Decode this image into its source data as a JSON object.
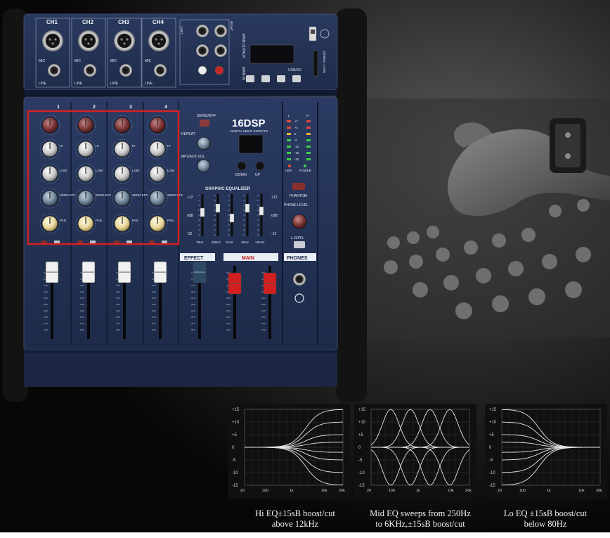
{
  "mixer": {
    "channels": [
      "CH1",
      "CH2",
      "CH3",
      "CH4"
    ],
    "channel_numbers": [
      "1",
      "2",
      "3",
      "4"
    ],
    "jack_labels": {
      "mic": "MIC",
      "line": "LINE"
    },
    "knob_labels": {
      "hi": "HI",
      "low": "LOW",
      "send_eff": "SEND EFF",
      "pan": "PAN"
    },
    "io_labels": {
      "left": "LEFT",
      "right": "RIGHT",
      "main_out": "MAIN OUT",
      "aux": "AUX",
      "main_in": "MAIN IN",
      "rca": "RCA",
      "usb_sd": "USB/SD",
      "sd_card": "SD/MMC CARD"
    },
    "dsp": {
      "logo": "16DSP",
      "subtitle": "DIGITAL MULTI EFFECTS",
      "down": "DOWN",
      "up": "UP"
    },
    "effects": {
      "send_eff": "SEND/EFF",
      "repeat": "REPEAT",
      "mp3_aux_vol": "MP3/AUX VOL"
    },
    "eq": {
      "title": "GRAPHIC EQUALIZER",
      "scale": [
        "+12",
        "0dB",
        "-12"
      ],
      "bands": [
        "75Hz",
        "250Hz",
        "1KHz",
        "3KHz",
        "12KHz"
      ]
    },
    "meter": {
      "levels": [
        "+7",
        "+4",
        "0",
        "-5",
        "-10",
        "-15",
        "-20"
      ],
      "left": "L",
      "right": "R"
    },
    "right_panel": {
      "plus48v": "+48V",
      "power": "POWER",
      "phantom": "PHANTOM",
      "phone_level": "PHONE LEVEL",
      "lr_pfl": "L-R/PFL",
      "phones": "PHONES"
    },
    "fader_sections": {
      "effect": "EFFECT",
      "main": "MAIN"
    },
    "colors": {
      "panel": "#253458",
      "highlight_box": "#d42020",
      "main_fader": "#d21f1f",
      "pan_knob": "#e7d79a"
    }
  },
  "eq_graphs": {
    "y_ticks": [
      "+15",
      "+10",
      "+5",
      "0",
      "-5",
      "-10",
      "-15"
    ],
    "x_ticks": [
      "20Hz",
      "100Hz",
      "1KHz",
      "10KHz",
      "20KHz"
    ],
    "x_tick_display": [
      "20",
      "100",
      "1k",
      "10k",
      "20k"
    ]
  },
  "captions": [
    {
      "line1": "Hi EQ±15sB boost/cut",
      "line2": "above 12kHz"
    },
    {
      "line1": "Mid EQ sweeps from 250Hz",
      "line2": "to 6KHz,±15sB boost/cut"
    },
    {
      "line1": "Lo EQ ±15sB boost/cut",
      "line2": "below 80Hz"
    }
  ]
}
